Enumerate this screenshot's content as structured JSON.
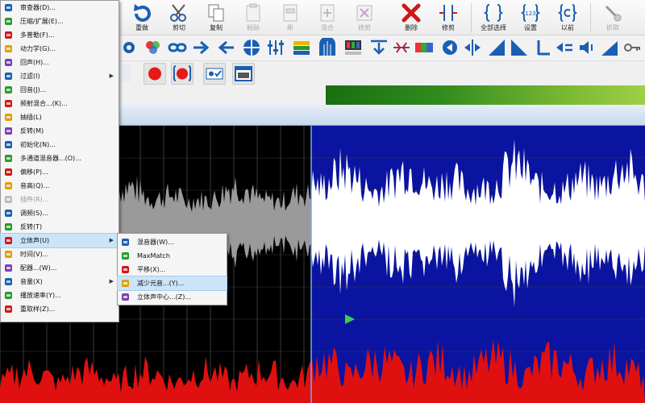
{
  "toolbar_main": {
    "buttons": [
      {
        "label": "重做",
        "icon": "redo-icon",
        "enabled": true
      },
      {
        "label": "剪切",
        "icon": "scissors-icon",
        "enabled": true
      },
      {
        "label": "复制",
        "icon": "copy-icon",
        "enabled": true
      },
      {
        "label": "粘贴",
        "icon": "paste-icon",
        "enabled": false
      },
      {
        "label": "新",
        "icon": "new-icon",
        "enabled": false
      },
      {
        "label": "混合",
        "icon": "mix-paste-icon",
        "enabled": false
      },
      {
        "label": "修剪",
        "icon": "trim-icon",
        "enabled": false
      },
      {
        "label": "删除",
        "icon": "delete-icon",
        "enabled": true
      },
      {
        "label": "修剪",
        "icon": "trim-selection-icon",
        "enabled": true
      },
      {
        "label": "全部选择",
        "icon": "select-all-icon",
        "enabled": true
      },
      {
        "label": "设置",
        "icon": "set-selection-icon",
        "enabled": true
      },
      {
        "label": "以前",
        "icon": "previous-selection-icon",
        "enabled": true
      },
      {
        "label": "抓取",
        "icon": "grab-icon",
        "enabled": false
      }
    ]
  },
  "menu": {
    "items": [
      {
        "label": "审查器(D)...",
        "icon": "inspector-icon"
      },
      {
        "label": "压缩/扩展(E)...",
        "icon": "compress-icon"
      },
      {
        "label": "多普勒(F)...",
        "icon": "doppler-icon"
      },
      {
        "label": "动力学(G)...",
        "icon": "dynamics-icon"
      },
      {
        "label": "回声(H)...",
        "icon": "echo-icon"
      },
      {
        "label": "过滤(I)",
        "icon": "filter-icon",
        "submenu": true
      },
      {
        "label": "回音(J)...",
        "icon": "reverb-icon"
      },
      {
        "label": "频射混合...(K)...",
        "icon": "mix-icon"
      },
      {
        "label": "抽插(L)",
        "icon": "flanger-icon"
      },
      {
        "label": "反转(M)",
        "icon": "invert-icon"
      },
      {
        "label": "初始化(N)...",
        "icon": "normalize-icon"
      },
      {
        "label": "多通道混音器...(O)...",
        "icon": "multichannel-icon"
      },
      {
        "label": "偏移(P)...",
        "icon": "offset-icon"
      },
      {
        "label": "音高(Q)...",
        "icon": "pitch-icon"
      },
      {
        "label": "插件(R)...",
        "icon": "plugin-icon",
        "disabled": true
      },
      {
        "label": "调频(S)...",
        "icon": "modulate-icon"
      },
      {
        "label": "反转(T)",
        "icon": "reverse-icon"
      },
      {
        "label": "立体声(U)",
        "icon": "stereo-icon",
        "submenu": true,
        "highlighted": true
      },
      {
        "label": "时间(V)...",
        "icon": "time-icon"
      },
      {
        "label": "配器...(W)...",
        "icon": "arrange-icon"
      },
      {
        "label": "音量(X)",
        "icon": "volume-icon",
        "submenu": true
      },
      {
        "label": "播放速率(Y)...",
        "icon": "speed-icon"
      },
      {
        "label": "重取样(Z)...",
        "icon": "resample-icon"
      }
    ]
  },
  "submenu": {
    "items": [
      {
        "label": "混音器(W)...",
        "icon": "mixer-icon"
      },
      {
        "label": "MaxMatch",
        "icon": "maxmatch-icon"
      },
      {
        "label": "平移(X)...",
        "icon": "pan-icon"
      },
      {
        "label": "减少元音...(Y)...",
        "icon": "vocal-reduce-icon",
        "highlighted": true
      },
      {
        "label": "立体声中心...(Z)...",
        "icon": "stereo-center-icon"
      }
    ]
  },
  "colors": {
    "wave_selected_bg": "#0a14a0",
    "wave_unselected_bg": "#000000",
    "wave_selected_fg": "#ffffff",
    "wave_unselected_fg": "#9a9a9a",
    "spectrum": "#e01010",
    "menu_highlight": "#cce4f7"
  }
}
